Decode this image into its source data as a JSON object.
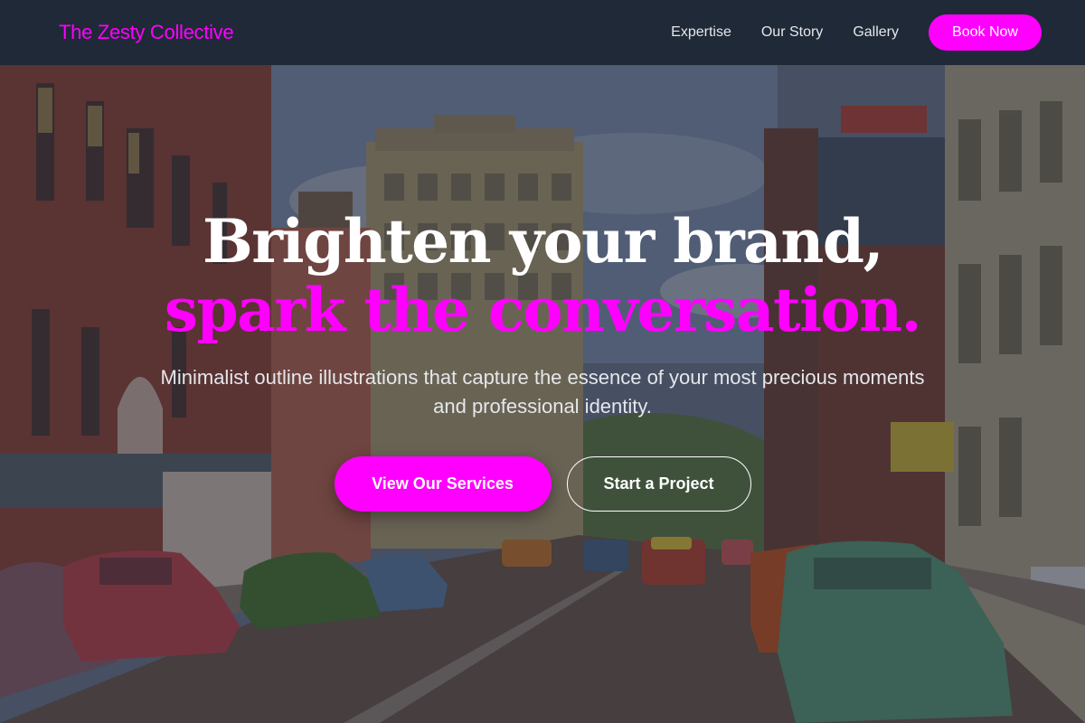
{
  "nav": {
    "brand": "The Zesty Collective",
    "links": [
      "Expertise",
      "Our Story",
      "Gallery"
    ],
    "cta": "Book Now"
  },
  "hero": {
    "headline_line1": "Brighten your brand,",
    "headline_line2": "spark the conversation.",
    "subtitle": "Minimalist outline illustrations that capture the essence of your most precious moments and professional identity.",
    "primary_button": "View Our Services",
    "secondary_button": "Start a Project",
    "background_image": "vintage-street-scene"
  },
  "colors": {
    "accent": "#ff00ff",
    "navbar_bg": "#1f2937",
    "nav_text": "#e5e7eb",
    "headline_text": "#ffffff"
  }
}
